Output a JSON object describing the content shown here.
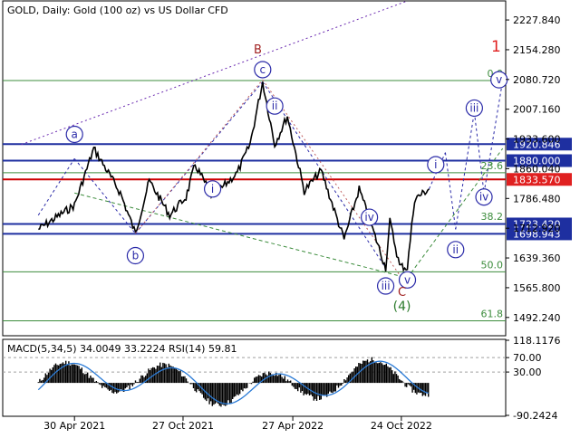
{
  "header": {
    "symbol_line": "GOLD, Daily:  Gold (100 oz) vs US Dollar CFD"
  },
  "colors": {
    "candle": "#000000",
    "grid": "#c0c0c0",
    "fib": "#3c8c3c",
    "level_blue": "#1e2fa0",
    "level_red": "#cc0000",
    "wave_blue": "#2a2aa8",
    "wave_red": "#a02020",
    "badge_blue": "#1e2fa0",
    "badge_red": "#e02020",
    "macd_hist": "#000000",
    "macd_signal": "#2b7bd6"
  },
  "chart_data": [
    {
      "type": "line",
      "title": "GOLD, Daily:  Gold (100 oz) vs US Dollar CFD",
      "series": [
        {
          "name": "GOLD",
          "x": [
            "2021-03-01",
            "2021-04-30",
            "2021-06-01",
            "2021-07-15",
            "2021-08-09",
            "2021-09-01",
            "2021-10-05",
            "2021-11-01",
            "2021-11-16",
            "2021-12-15",
            "2022-01-25",
            "2022-02-15",
            "2022-03-08",
            "2022-03-28",
            "2022-04-18",
            "2022-05-16",
            "2022-06-13",
            "2022-07-21",
            "2022-08-15",
            "2022-09-28",
            "2022-10-05",
            "2022-10-21",
            "2022-11-03",
            "2022-11-15",
            "2022-12-09"
          ],
          "y": [
            1710,
            1770,
            1910,
            1800,
            1700,
            1830,
            1745,
            1790,
            1870,
            1790,
            1850,
            1920,
            2075,
            1920,
            1990,
            1805,
            1855,
            1685,
            1810,
            1615,
            1730,
            1620,
            1615,
            1785,
            1810
          ]
        }
      ],
      "x_ticks": [
        "30 Apr 2021",
        "27 Oct 2021",
        "27 Apr 2022",
        "24 Oct 2022"
      ],
      "y_ticks": [
        "2227.840",
        "2154.280",
        "2080.720",
        "2007.160",
        "1933.600",
        "1860.040",
        "1786.480",
        "1712.920",
        "1639.360",
        "1565.800",
        "1492.240"
      ],
      "ylim": [
        1447,
        2275
      ],
      "levels": [
        {
          "label": "1920.846",
          "value": 1920.846,
          "color": "blue"
        },
        {
          "label": "1880.000",
          "value": 1880.0,
          "color": "blue"
        },
        {
          "label": "1833.570",
          "value": 1833.57,
          "color": "red"
        },
        {
          "label": "1723.420",
          "value": 1723.42,
          "color": "blue"
        },
        {
          "label": "1698.943",
          "value": 1698.943,
          "color": "blue"
        }
      ],
      "fib_levels": [
        {
          "label": "0.0",
          "value": 2078
        },
        {
          "label": "23.6",
          "value": 1850
        },
        {
          "label": "38.2",
          "value": 1724
        },
        {
          "label": "50.0",
          "value": 1605
        },
        {
          "label": "61.8",
          "value": 1484
        }
      ],
      "wave_labels": [
        "a",
        "b",
        "c",
        "B",
        "1",
        "i",
        "ii",
        "iii",
        "iv",
        "v",
        "i",
        "ii",
        "iii",
        "iv",
        "v",
        "iii",
        "iv",
        "v",
        "C",
        "(4)"
      ],
      "grid": false
    },
    {
      "type": "bar",
      "title": "MACD(5,34,5) 34.0049 33.2224 RSI(14) 59.81",
      "x_ticks": [
        "30 Apr 2021",
        "27 Oct 2021",
        "27 Apr 2022",
        "24 Oct 2022"
      ],
      "y_ticks": [
        "118.1176",
        "70.00",
        "30.00",
        "-90.2424"
      ],
      "ylim": [
        -90.2424,
        118.1176
      ],
      "reference_lines": [
        70,
        30
      ]
    }
  ],
  "macd_header": "MACD(5,34,5) 34.0049 33.2224 RSI(14) 59.81"
}
